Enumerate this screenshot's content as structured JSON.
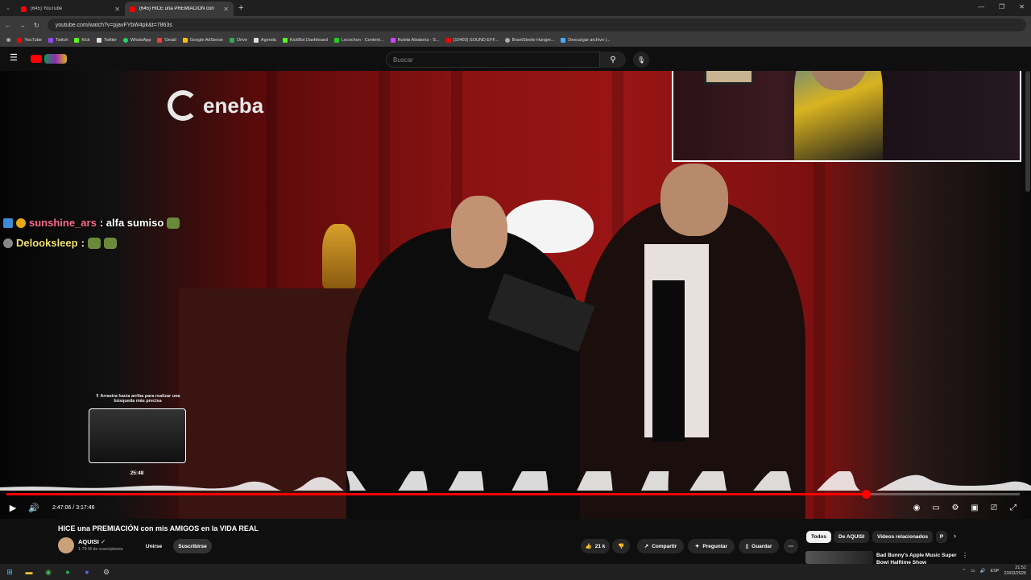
{
  "browser": {
    "tabs": [
      {
        "title": "(645) YouTube",
        "active": false
      },
      {
        "title": "(645) HICE una PREMIACIÓN con",
        "active": true
      }
    ],
    "url": "youtube.com/watch?v=pjavFYbW4pk&t=7863s",
    "bookmarks": [
      "YouTube",
      "Twitch",
      "Kick",
      "Twitter",
      "WhatsApp",
      "Gmail",
      "Google AdSense",
      "Drive",
      "Agenda",
      "KickBot Dashboard",
      "Locochon - Content...",
      "Ruleta Aleatoria - S...",
      "(10403) SOUND EFF...",
      "BrantSteele Hunger...",
      "Descargar archivo |..."
    ]
  },
  "youtube": {
    "search_placeholder": "Buscar"
  },
  "video": {
    "sponsor_logo": "eneba",
    "chat": [
      {
        "user": "sunshine_ars",
        "message": ": alfa sumiso",
        "color": "#ff6b8a"
      },
      {
        "user": "Delooksleep",
        "message": " :",
        "color": "#f0e070"
      }
    ],
    "preview_hint": "⇑ Arrastra hacia arriba para realizar una búsqueda más precisa",
    "preview_time": "25:48",
    "current_time": "2:47:06 / 3:17:46",
    "progress_fraction": 0.848,
    "preview_fraction": 0.13
  },
  "info": {
    "title": "HICE una PREMIACIÓN con mis AMIGOS en la VIDA REAL",
    "channel": "AQUISI",
    "subscribers": "1.79 M de suscriptores",
    "join_label": "Unirse",
    "subscribe_label": "Suscribirse",
    "likes": "21 k",
    "share_label": "Compartir",
    "ask_label": "Preguntar",
    "save_label": "Guardar",
    "chips": [
      "Todos",
      "De AQUISI",
      "Videos relacionados",
      "P"
    ],
    "recommended_title": "Bad Bunny's Apple Music Super Bowl Halftime Show"
  },
  "taskbar": {
    "lang": "ESP",
    "time": "21:51",
    "date": "23/03/2026"
  },
  "colors": {
    "accent": "#ff0000",
    "bg": "#0f0f0f"
  }
}
